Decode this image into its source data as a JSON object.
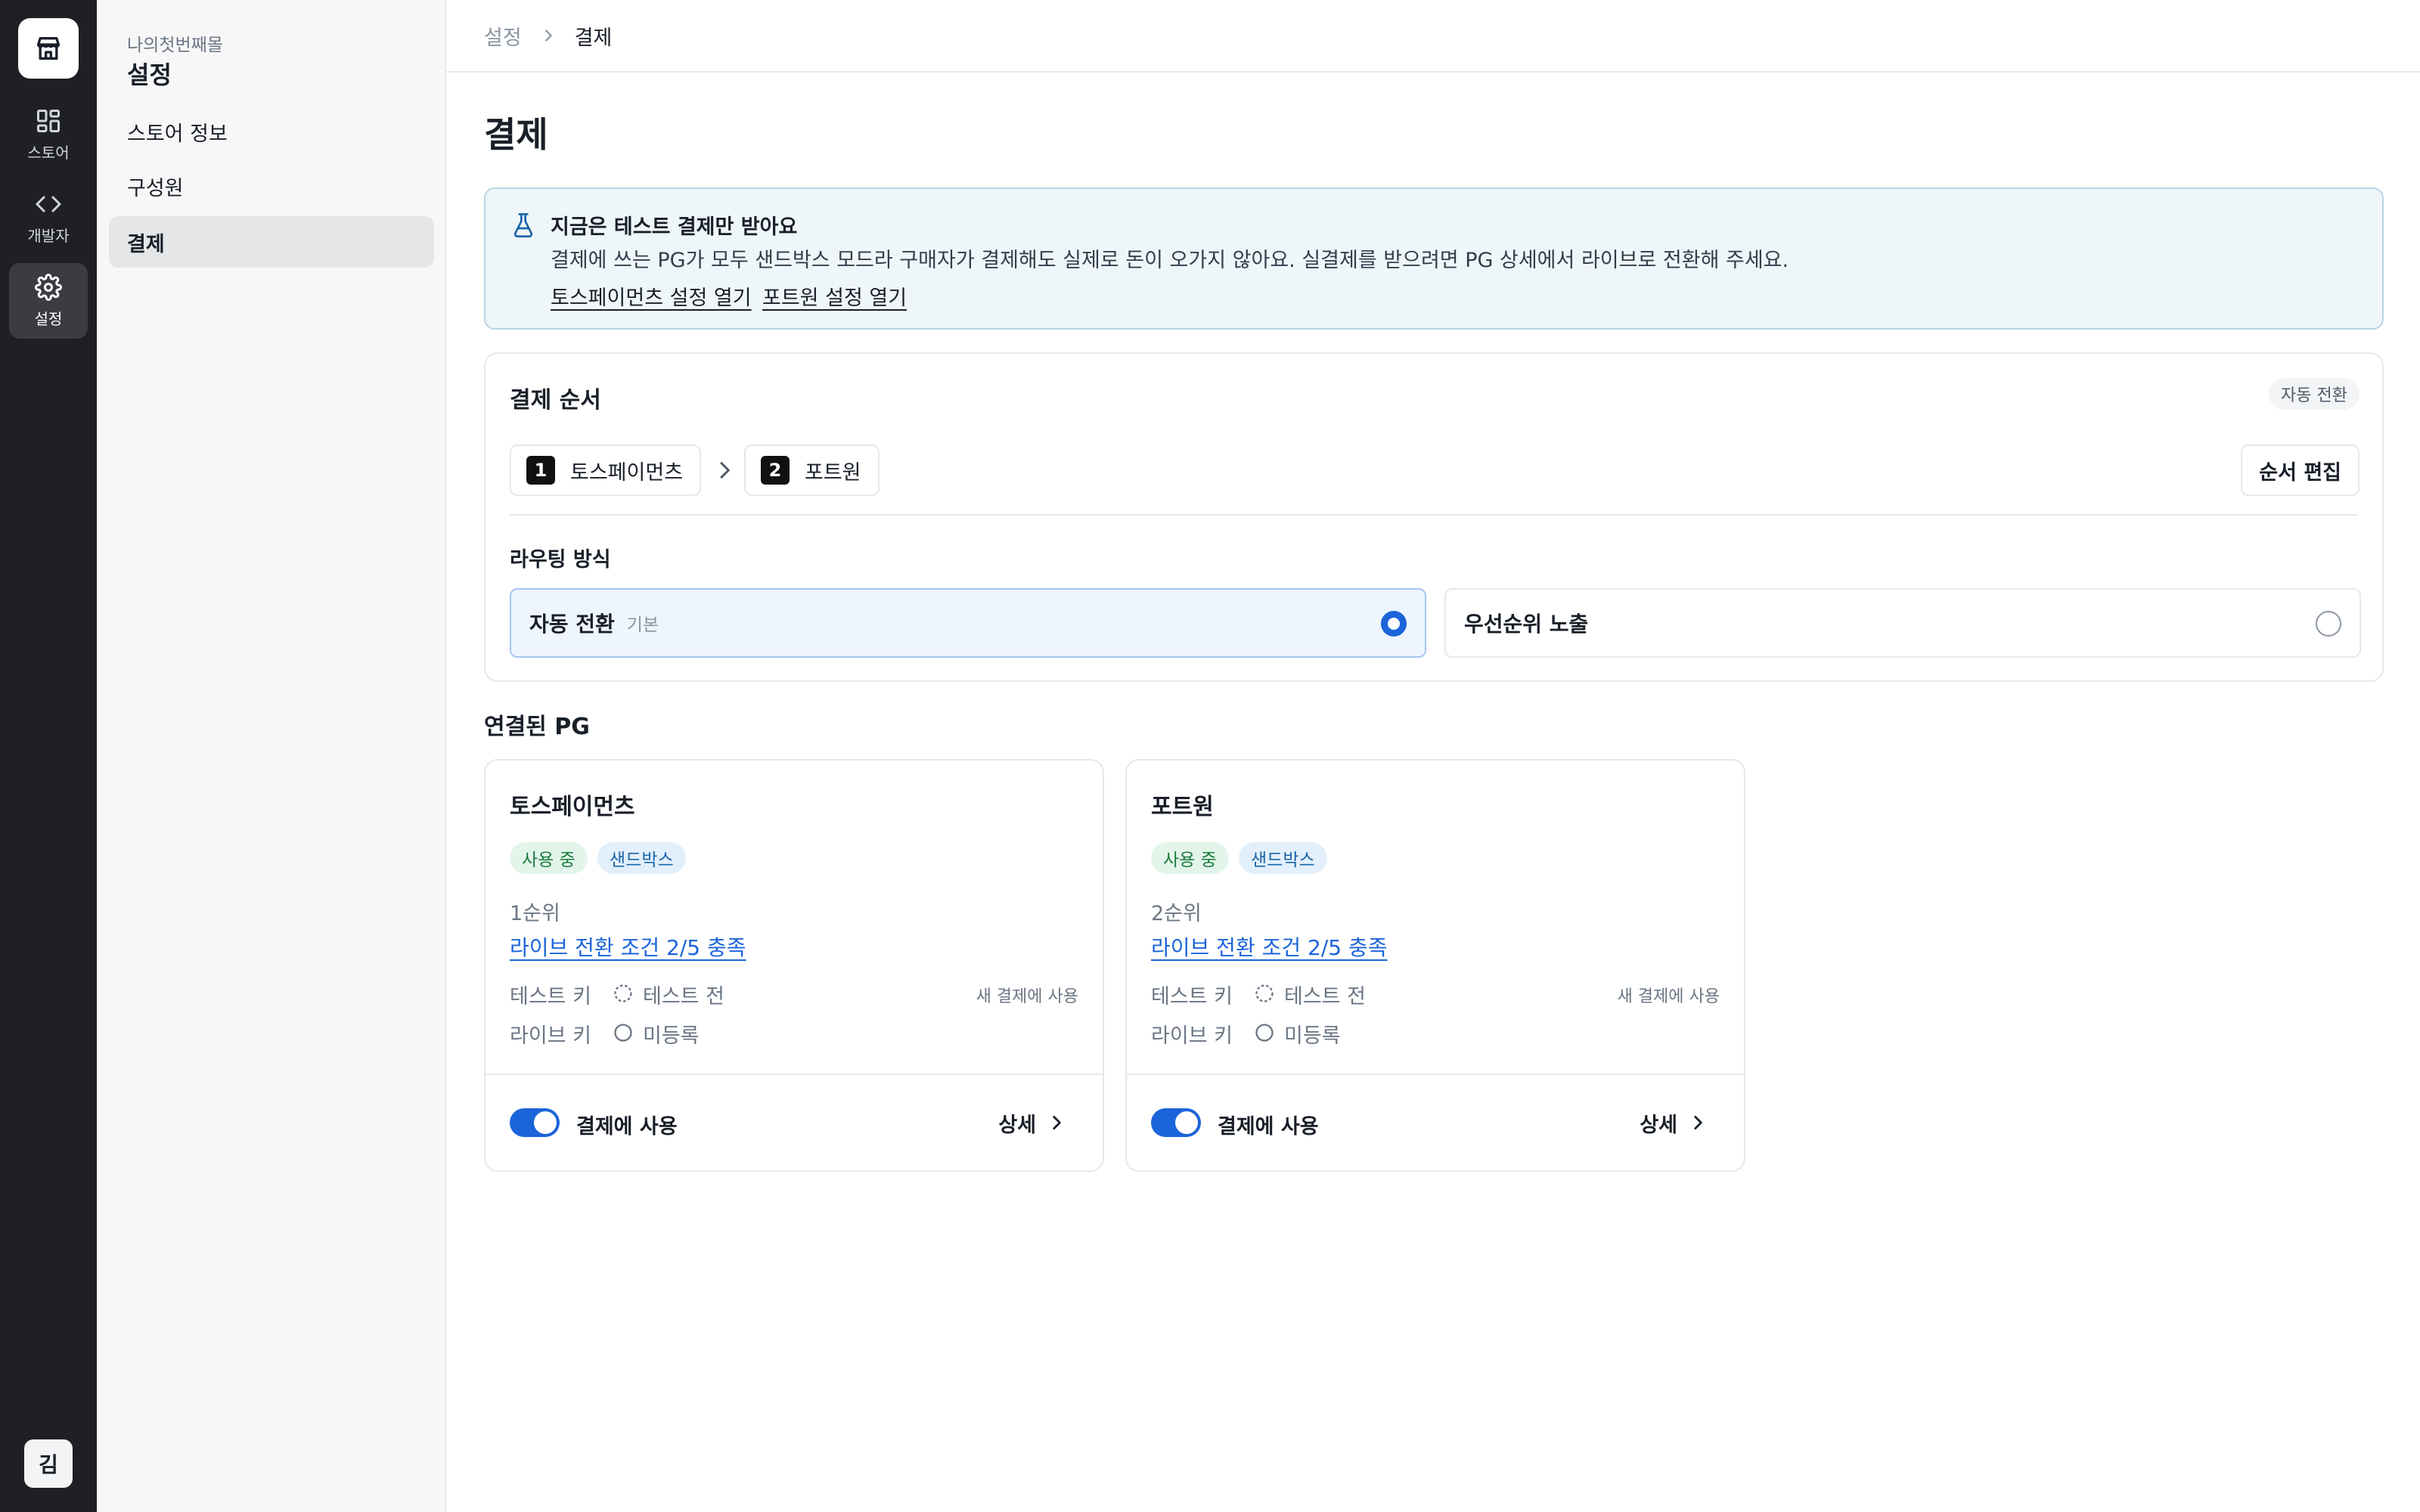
{
  "rail": {
    "items": [
      {
        "label": "스토어",
        "icon": "grid-icon"
      },
      {
        "label": "개발자",
        "icon": "code-icon"
      },
      {
        "label": "설정",
        "icon": "gear-icon"
      }
    ],
    "avatar": "김"
  },
  "sidebar": {
    "store_name": "나의첫번째몰",
    "title": "설정",
    "items": [
      {
        "label": "스토어 정보"
      },
      {
        "label": "구성원"
      },
      {
        "label": "결제"
      }
    ]
  },
  "breadcrumb": {
    "parent": "설정",
    "current": "결제"
  },
  "page": {
    "title": "결제"
  },
  "notice": {
    "title": "지금은 테스트 결제만 받아요",
    "body": "결제에 쓰는 PG가 모두 샌드박스 모드라 구매자가 결제해도 실제로 돈이 오가지 않아요. 실결제를 받으려면 PG 상세에서 라이브로 전환해 주세요.",
    "links": [
      "토스페이먼츠 설정 열기",
      "포트원 설정 열기"
    ]
  },
  "order": {
    "title": "결제 순서",
    "badge": "자동 전환",
    "steps": [
      {
        "num": "1",
        "label": "토스페이먼츠"
      },
      {
        "num": "2",
        "label": "포트원"
      }
    ],
    "edit_label": "순서 편집",
    "routing_label": "라우팅 방식",
    "options": [
      {
        "label": "자동 전환",
        "sub": "기본",
        "selected": true
      },
      {
        "label": "우선순위 노출",
        "sub": "",
        "selected": false
      }
    ]
  },
  "connected": {
    "title": "연결된 PG",
    "pgs": [
      {
        "name": "토스페이먼츠",
        "badges": [
          "사용 중",
          "샌드박스"
        ],
        "rank": "1순위",
        "live_link": "라이브 전환 조건 2/5 충족",
        "test_key_label": "테스트 키",
        "test_key_value": "테스트 전",
        "test_key_note": "새 결제에 사용",
        "live_key_label": "라이브 키",
        "live_key_value": "미등록",
        "toggle_label": "결제에 사용",
        "toggle_on": true,
        "detail_label": "상세"
      },
      {
        "name": "포트원",
        "badges": [
          "사용 중",
          "샌드박스"
        ],
        "rank": "2순위",
        "live_link": "라이브 전환 조건 2/5 충족",
        "test_key_label": "테스트 키",
        "test_key_value": "테스트 전",
        "test_key_note": "새 결제에 사용",
        "live_key_label": "라이브 키",
        "live_key_value": "미등록",
        "toggle_label": "결제에 사용",
        "toggle_on": true,
        "detail_label": "상세"
      }
    ]
  },
  "colors": {
    "accent": "#1b64da",
    "rail_bg": "#1f2023",
    "notice_bg": "#eef6fa"
  }
}
